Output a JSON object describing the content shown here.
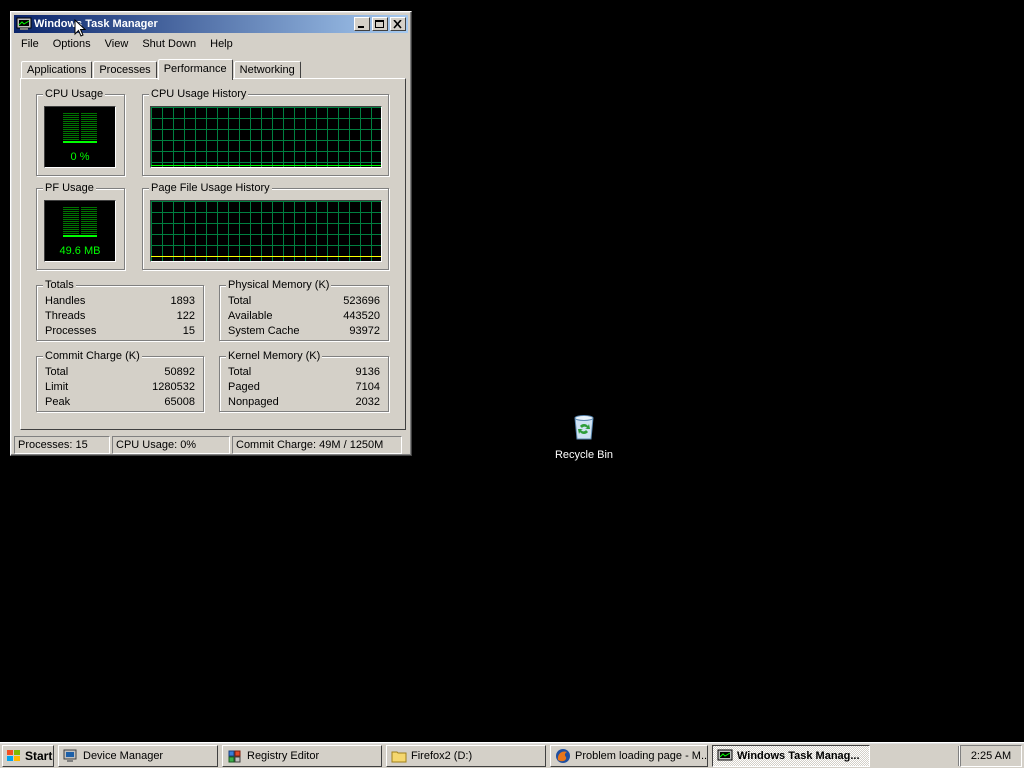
{
  "window": {
    "title": "Windows Task Manager",
    "menu": [
      "File",
      "Options",
      "View",
      "Shut Down",
      "Help"
    ],
    "tabs": [
      "Applications",
      "Processes",
      "Performance",
      "Networking"
    ],
    "active_tab": "Performance"
  },
  "performance": {
    "cpu_usage": {
      "label": "CPU Usage",
      "value": "0 %",
      "level": 0.0
    },
    "cpu_history": {
      "label": "CPU Usage History"
    },
    "pf_usage": {
      "label": "PF Usage",
      "value": "49.6 MB",
      "level": 0.04
    },
    "pf_history": {
      "label": "Page File Usage History"
    },
    "totals": {
      "label": "Totals",
      "rows": [
        {
          "name": "Handles",
          "value": "1893"
        },
        {
          "name": "Threads",
          "value": "122"
        },
        {
          "name": "Processes",
          "value": "15"
        }
      ]
    },
    "physical_memory": {
      "label": "Physical Memory (K)",
      "rows": [
        {
          "name": "Total",
          "value": "523696"
        },
        {
          "name": "Available",
          "value": "443520"
        },
        {
          "name": "System Cache",
          "value": "93972"
        }
      ]
    },
    "commit_charge": {
      "label": "Commit Charge (K)",
      "rows": [
        {
          "name": "Total",
          "value": "50892"
        },
        {
          "name": "Limit",
          "value": "1280532"
        },
        {
          "name": "Peak",
          "value": "65008"
        }
      ]
    },
    "kernel_memory": {
      "label": "Kernel Memory (K)",
      "rows": [
        {
          "name": "Total",
          "value": "9136"
        },
        {
          "name": "Paged",
          "value": "7104"
        },
        {
          "name": "Nonpaged",
          "value": "2032"
        }
      ]
    }
  },
  "statusbar": {
    "processes": "Processes: 15",
    "cpu": "CPU Usage: 0%",
    "commit": "Commit Charge: 49M / 1250M"
  },
  "desktop": {
    "recycle_bin": "Recycle Bin"
  },
  "taskbar": {
    "start": "Start",
    "buttons": [
      {
        "label": "Device Manager",
        "icon": "device-manager-icon"
      },
      {
        "label": "Registry Editor",
        "icon": "registry-editor-icon"
      },
      {
        "label": "Firefox2 (D:)",
        "icon": "folder-icon"
      },
      {
        "label": "Problem loading page - M...",
        "icon": "firefox-icon"
      },
      {
        "label": "Windows Task Manag...",
        "icon": "task-manager-icon"
      }
    ],
    "clock": "2:25 AM"
  },
  "colors": {
    "titlebar_start": "#0a246a",
    "titlebar_end": "#a6caf0",
    "meter_green": "#00ff00",
    "grid_green": "#008040",
    "chrome": "#d4d0c8"
  }
}
